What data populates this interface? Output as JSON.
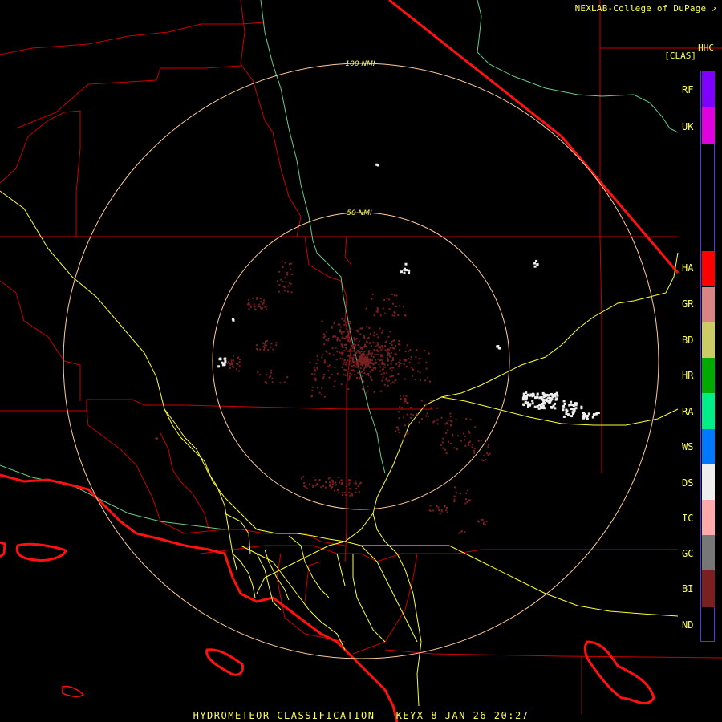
{
  "header": {
    "credit": "NEXLAB-College of DuPage",
    "credit_icon": "external-link-icon",
    "product_code": "HHC",
    "product_sub": "[CLAS]"
  },
  "rings": {
    "inner_label": "50 NMI",
    "outer_label": "100 NMI"
  },
  "legend": {
    "items": [
      {
        "code": "RF",
        "color": "#7f00ff"
      },
      {
        "code": "UK",
        "color": "#e000e0"
      },
      {
        "code": "HA",
        "color": "#ff0000"
      },
      {
        "code": "GR",
        "color": "#d98585"
      },
      {
        "code": "BD",
        "color": "#cccc66"
      },
      {
        "code": "HR",
        "color": "#00aa00"
      },
      {
        "code": "RA",
        "color": "#00ee88"
      },
      {
        "code": "WS",
        "color": "#0077ff"
      },
      {
        "code": "DS",
        "color": "#eeeeee"
      },
      {
        "code": "IC",
        "color": "#ffaaaa"
      },
      {
        "code": "GC",
        "color": "#777777"
      },
      {
        "code": "BI",
        "color": "#7a2020"
      },
      {
        "code": "ND",
        "color": "#000000"
      }
    ]
  },
  "footer": {
    "caption": "HYDROMETEOR CLASSIFICATION - KEYX 8 JAN 26 20:27"
  },
  "colors": {
    "state_lines": "#cc0000",
    "coast_line": "#ff1111",
    "highways": "#ffff33",
    "river_line": "#66cc88",
    "range_rings": "#ffcc99",
    "biological_echo": "#7a2020",
    "dry_snow_echo": "#eeeeee"
  }
}
